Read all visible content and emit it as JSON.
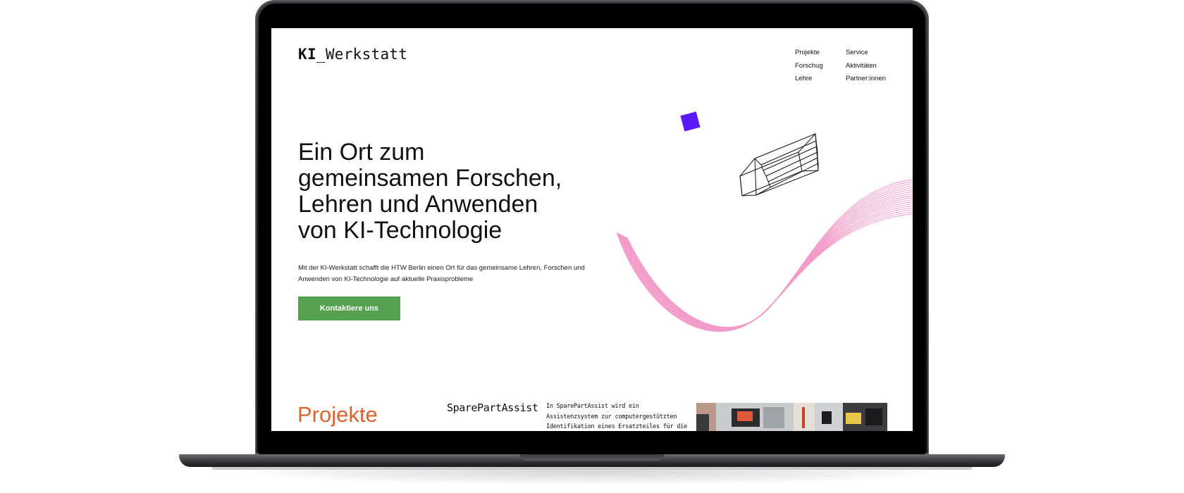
{
  "site": {
    "logo": {
      "prefix": "KI",
      "suffix": "_Werkstatt"
    }
  },
  "nav": {
    "col1": [
      "Projekte",
      "Forschug",
      "Lehre"
    ],
    "col2": [
      "Service",
      "Aktivitäten",
      "Partner:innen"
    ]
  },
  "hero": {
    "title_lines": [
      "Ein Ort zum",
      "gemeinsamen Forschen,",
      "Lehren und Anwenden",
      "von KI-Technologie"
    ],
    "text": "Mit der KI-Werkstatt schafft die HTW Berlin einen Ort für das gemeinsame Lehren, Forschen und Anwenden von KI-Technologie auf aktuelle Praxisprobleme",
    "cta_label": "Kontaktiere uns"
  },
  "projects": {
    "section_title": "Projekte",
    "items": [
      {
        "name": "SparePartAssist",
        "description": "In SparePartAssist wird ein Assistenzsystem zur computergestützten Identifikation eines Ersatzteiles für die Wartung und Reparatur"
      }
    ]
  },
  "colors": {
    "accent_green": "#56a150",
    "accent_orange": "#d8642f",
    "accent_purple": "#5b19ff",
    "wave_pink": "#f29ac8"
  }
}
